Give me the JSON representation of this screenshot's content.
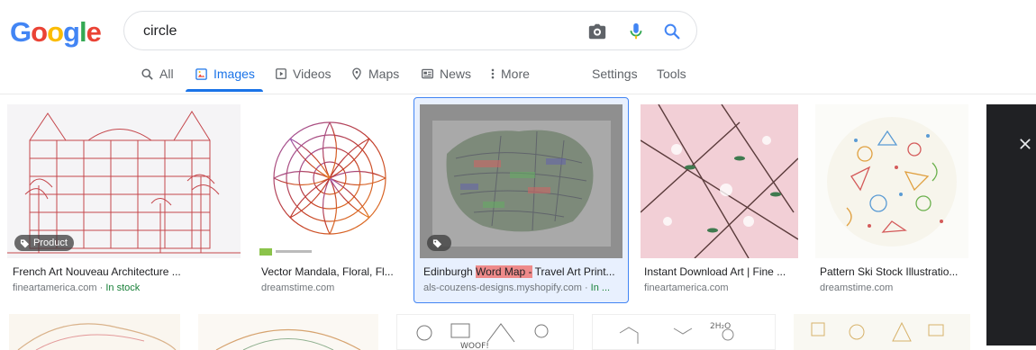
{
  "logo": {
    "letters": [
      "G",
      "o",
      "o",
      "g",
      "l",
      "e"
    ],
    "colors": [
      "#4285f4",
      "#ea4335",
      "#fbbc05",
      "#4285f4",
      "#34a853",
      "#ea4335"
    ]
  },
  "search": {
    "query": "circle"
  },
  "tabs": {
    "all": "All",
    "images": "Images",
    "videos": "Videos",
    "maps": "Maps",
    "news": "News",
    "more": "More",
    "settings": "Settings",
    "tools": "Tools"
  },
  "results": [
    {
      "title": "French Art Nouveau Architecture ...",
      "source": "fineartamerica.com",
      "extra": "In stock",
      "badge": "Product"
    },
    {
      "title": "Vector Mandala, Floral, Fl...",
      "source": "dreamstime.com"
    },
    {
      "title_pre": "Edinburgh ",
      "title_hl": "Word Map -",
      "title_post": " Travel Art Print...",
      "source": "als-couzens-designs.myshopify.com",
      "source_extra": "In ..."
    },
    {
      "title": "Instant Download Art | Fine ...",
      "source": "fineartamerica.com"
    },
    {
      "title": "Pattern Ski Stock Illustratio...",
      "source": "dreamstime.com"
    }
  ],
  "result_separator": "·",
  "colors": {
    "accent": "#1a73e8",
    "in_stock": "#188038",
    "panel": "#202124",
    "highlight": "#ee8a8a"
  }
}
